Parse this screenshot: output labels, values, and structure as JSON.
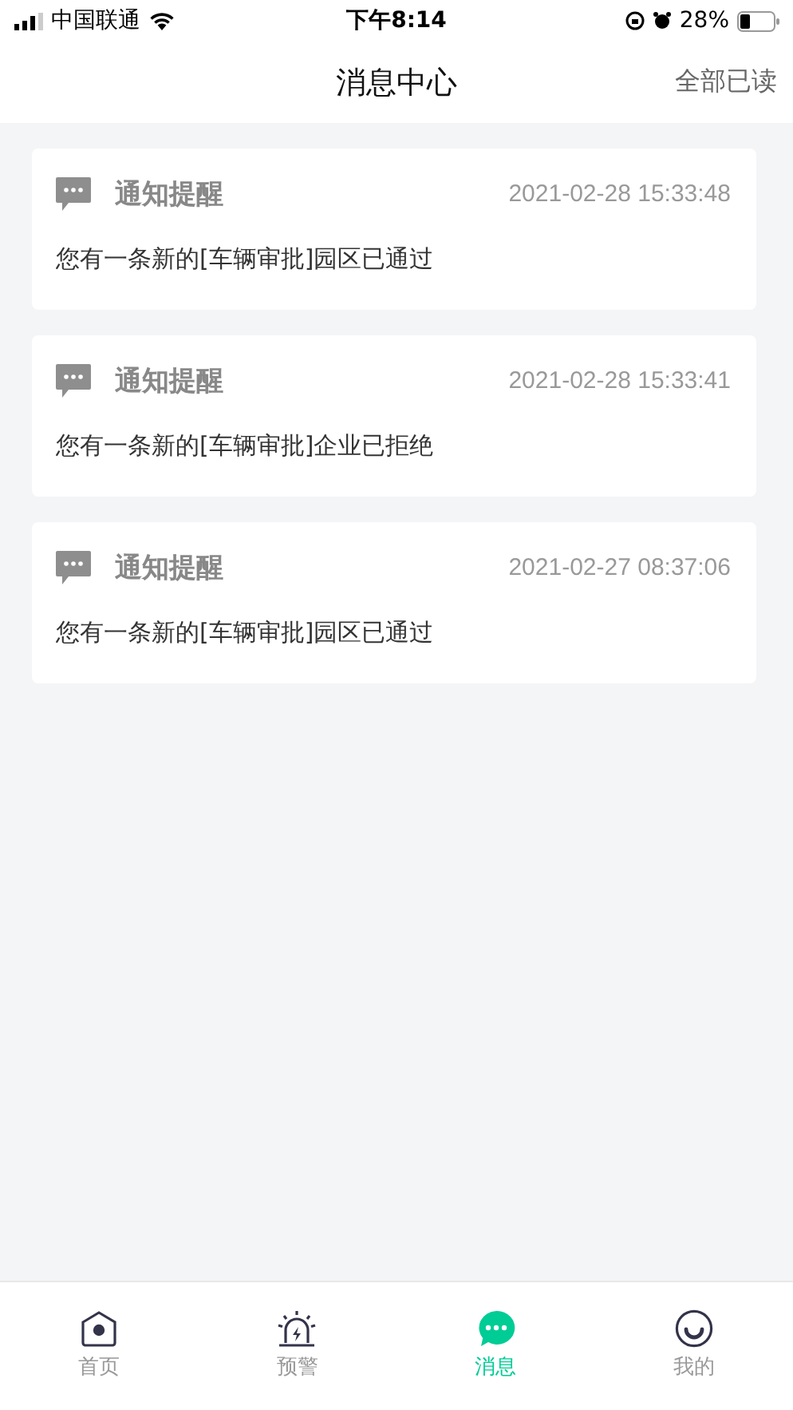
{
  "status_bar": {
    "carrier": "中国联通",
    "time": "下午8:14",
    "battery": "28%"
  },
  "nav": {
    "title": "消息中心",
    "action": "全部已读"
  },
  "messages": [
    {
      "title": "通知提醒",
      "time": "2021-02-28 15:33:48",
      "body": "您有一条新的[车辆审批]园区已通过"
    },
    {
      "title": "通知提醒",
      "time": "2021-02-28 15:33:41",
      "body": "您有一条新的[车辆审批]企业已拒绝"
    },
    {
      "title": "通知提醒",
      "time": "2021-02-27 08:37:06",
      "body": "您有一条新的[车辆审批]园区已通过"
    }
  ],
  "tabs": [
    {
      "kind": "home",
      "label": "首页",
      "selected": false
    },
    {
      "kind": "alarm",
      "label": "预警",
      "selected": false
    },
    {
      "kind": "chat",
      "label": "消息",
      "selected": true
    },
    {
      "kind": "smile",
      "label": "我的",
      "selected": false
    }
  ]
}
